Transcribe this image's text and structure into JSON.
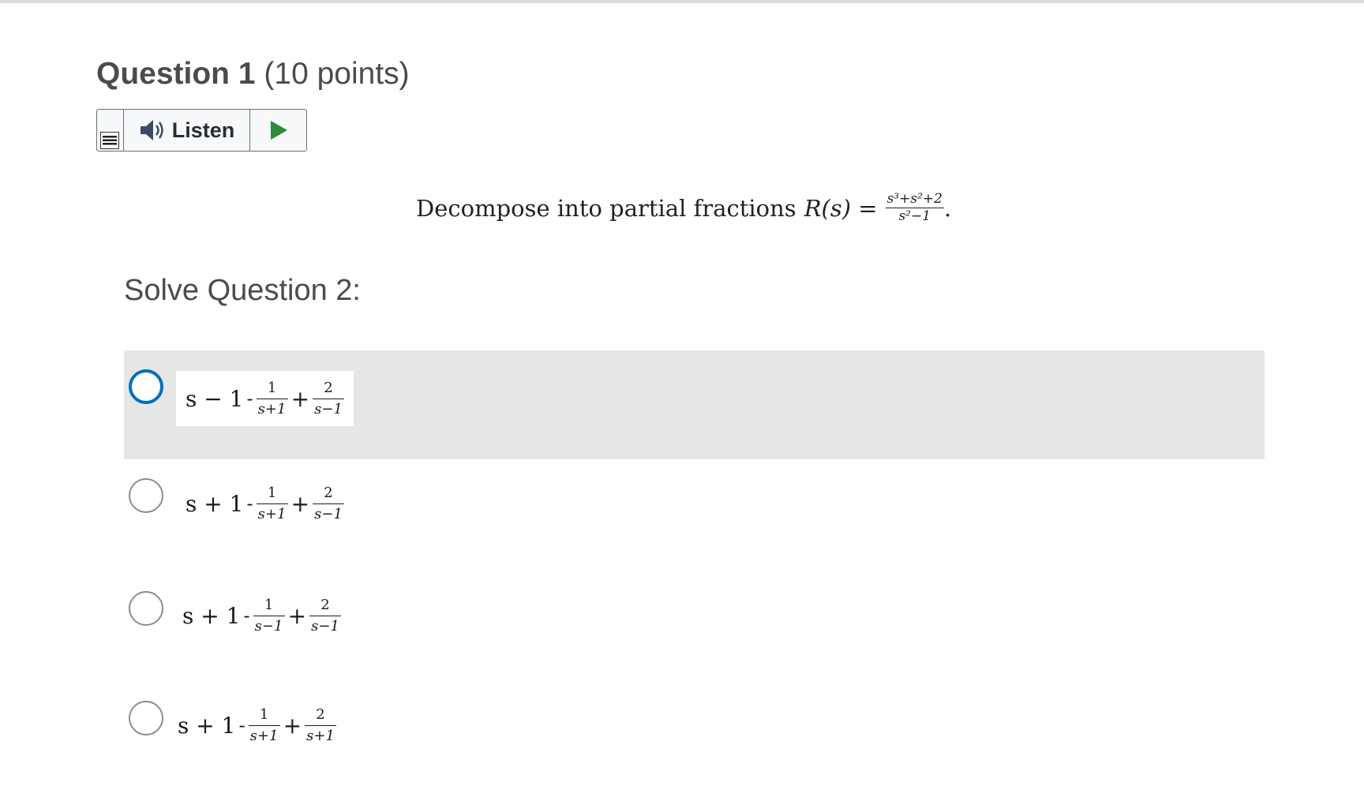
{
  "question": {
    "title": "Question 1",
    "points": "(10 points)"
  },
  "listen_toolbar": {
    "listen_label": "Listen"
  },
  "prompt": {
    "text": "Decompose into partial fractions",
    "lhs": "R(s) =",
    "numerator": "s³+s²+2",
    "denominator": "s²−1",
    "tail": "."
  },
  "sub_heading": "Solve Question 2:",
  "options": [
    {
      "lead": "s − 1",
      "sep": "-",
      "f1_num": "1",
      "f1_den": "s+1",
      "plus": "+",
      "f2_num": "2",
      "f2_den": "s−1",
      "selected": true
    },
    {
      "lead": "s + 1",
      "sep": "-",
      "f1_num": "1",
      "f1_den": "s+1",
      "plus": "+",
      "f2_num": "2",
      "f2_den": "s−1",
      "selected": false
    },
    {
      "lead": "s + 1",
      "sep": "-",
      "f1_num": "1",
      "f1_den": "s−1",
      "plus": "+",
      "f2_num": "2",
      "f2_den": "s−1",
      "selected": false
    },
    {
      "lead": "s + 1",
      "sep": "-",
      "f1_num": "1",
      "f1_den": "s+1",
      "plus": "+",
      "f2_num": "2",
      "f2_den": "s+1",
      "selected": false
    }
  ],
  "colors": {
    "focus_ring": "#006fbf",
    "selected_bg": "#e6e6e6",
    "play_icon": "#2e8b3a"
  }
}
